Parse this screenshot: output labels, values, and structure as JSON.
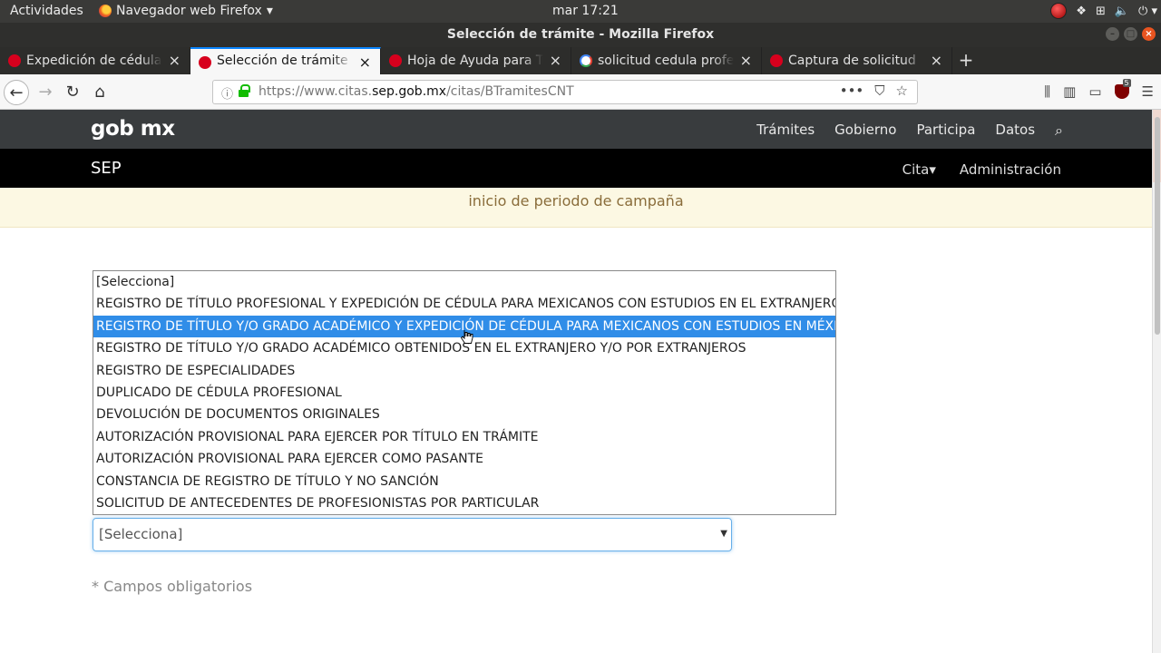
{
  "system": {
    "activities": "Actividades",
    "app_menu": "Navegador web Firefox",
    "clock": "mar 17:21"
  },
  "window": {
    "title": "Selección de trámite - Mozilla Firefox"
  },
  "tabs": [
    {
      "label": "Expedición de cédula pro",
      "active": false
    },
    {
      "label": "Selección de trámite",
      "active": true
    },
    {
      "label": "Hoja de Ayuda para Trám",
      "active": false
    },
    {
      "label": "solicitud cedula profesio",
      "active": false
    },
    {
      "label": "Captura de solicitud",
      "active": false
    }
  ],
  "url_bar": {
    "prefix": "https://www.citas.",
    "domain": "sep.gob.mx",
    "path": "/citas/BTramitesCNT"
  },
  "ublock_badge": "5",
  "gob_header": {
    "logo": "gob mx",
    "menu": [
      "Trámites",
      "Gobierno",
      "Participa",
      "Datos"
    ]
  },
  "sep_bar": {
    "brand": "SEP",
    "cita": "Cita",
    "admin": "Administración"
  },
  "notice": "inicio de periodo de campaña",
  "dropdown": {
    "options": [
      "[Selecciona]",
      "REGISTRO DE TÍTULO PROFESIONAL Y EXPEDICIÓN DE CÉDULA PARA MEXICANOS CON ESTUDIOS EN EL EXTRANJERO",
      "REGISTRO DE TÍTULO Y/O GRADO ACADÉMICO Y EXPEDICIÓN DE CÉDULA PARA MEXICANOS CON ESTUDIOS EN MÉXICO",
      "REGISTRO DE TÍTULO Y/O GRADO ACADÉMICO OBTENIDOS EN EL EXTRANJERO Y/O POR EXTRANJEROS",
      "REGISTRO DE ESPECIALIDADES",
      "DUPLICADO DE CÉDULA PROFESIONAL",
      "DEVOLUCIÓN DE DOCUMENTOS ORIGINALES",
      "AUTORIZACIÓN PROVISIONAL PARA EJERCER POR TÍTULO EN TRÁMITE",
      "AUTORIZACIÓN PROVISIONAL PARA EJERCER COMO PASANTE",
      "CONSTANCIA DE REGISTRO DE TÍTULO Y NO SANCIÓN",
      "SOLICITUD DE ANTECEDENTES DE PROFESIONISTAS POR PARTICULAR"
    ],
    "highlighted_index": 2
  },
  "select_value": "[Selecciona]",
  "required_note": "* Campos obligatorios",
  "colors": {
    "highlight": "#308de8",
    "gob_header": "#393c3e",
    "notice_bg": "#fcf8e3",
    "notice_text": "#8a6d3b"
  }
}
